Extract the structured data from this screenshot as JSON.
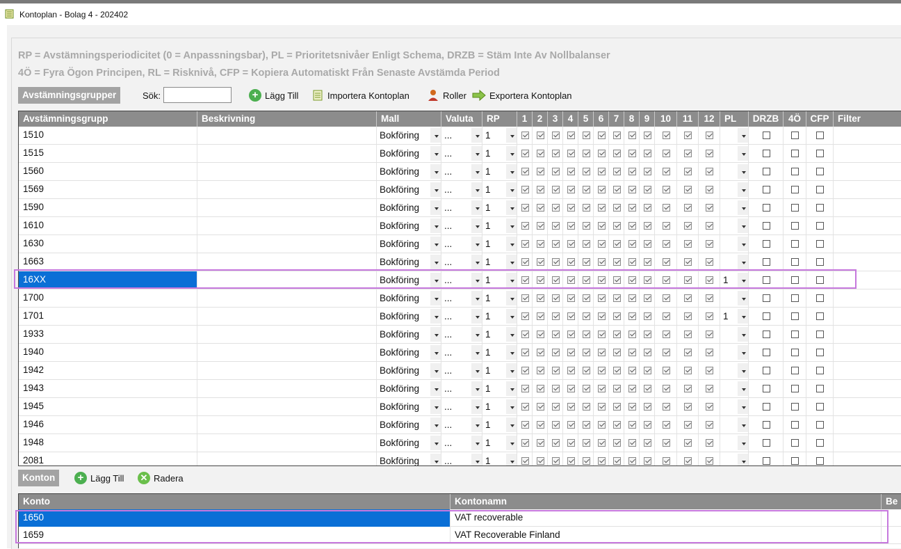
{
  "window": {
    "title": "Kontoplan - Bolag 4 - 202402"
  },
  "legend": {
    "line1": "RP = Avstämningsperiodicitet (0 = Anpassningsbar), PL = Prioritetsnivåer Enligt Schema, DRZB = Stäm Inte Av Nollbalanser",
    "line2": "4Ö = Fyra Ögon Principen, RL = Risknivå, CFP = Kopiera Automatiskt Från Senaste Avstämda Period"
  },
  "groups_toolbar": {
    "section_label": "Avstämningsgrupper",
    "search_label": "Sök:",
    "search_value": "",
    "add_label": "Lägg Till",
    "import_label": "Importera Kontoplan",
    "roles_label": "Roller",
    "export_label": "Exportera Kontoplan"
  },
  "groups_table": {
    "headers": {
      "group": "Avstämningsgrupp",
      "description": "Beskrivning",
      "template": "Mall",
      "currency": "Valuta",
      "rp": "RP",
      "p1": "1",
      "p2": "2",
      "p3": "3",
      "p4": "4",
      "p5": "5",
      "p6": "6",
      "p7": "7",
      "p8": "8",
      "p9": "9",
      "p10": "10",
      "p11": "11",
      "p12": "12",
      "pl": "PL",
      "drzb": "DRZB",
      "fo": "4Ö",
      "cfp": "CFP",
      "filter": "Filter"
    },
    "rows": [
      {
        "group": "1510",
        "description": "",
        "template": "Bokföring",
        "currency": "...",
        "rp": "1",
        "pl": "",
        "drzb": false,
        "fo": false,
        "cfp": false,
        "selected": false
      },
      {
        "group": "1515",
        "description": "",
        "template": "Bokföring",
        "currency": "...",
        "rp": "1",
        "pl": "",
        "drzb": false,
        "fo": false,
        "cfp": false,
        "selected": false
      },
      {
        "group": "1560",
        "description": "",
        "template": "Bokföring",
        "currency": "...",
        "rp": "1",
        "pl": "",
        "drzb": false,
        "fo": false,
        "cfp": false,
        "selected": false
      },
      {
        "group": "1569",
        "description": "",
        "template": "Bokföring",
        "currency": "...",
        "rp": "1",
        "pl": "",
        "drzb": false,
        "fo": false,
        "cfp": false,
        "selected": false
      },
      {
        "group": "1590",
        "description": "",
        "template": "Bokföring",
        "currency": "...",
        "rp": "1",
        "pl": "",
        "drzb": false,
        "fo": false,
        "cfp": false,
        "selected": false
      },
      {
        "group": "1610",
        "description": "",
        "template": "Bokföring",
        "currency": "...",
        "rp": "1",
        "pl": "",
        "drzb": false,
        "fo": false,
        "cfp": false,
        "selected": false
      },
      {
        "group": "1630",
        "description": "",
        "template": "Bokföring",
        "currency": "...",
        "rp": "1",
        "pl": "",
        "drzb": false,
        "fo": false,
        "cfp": false,
        "selected": false
      },
      {
        "group": "1663",
        "description": "",
        "template": "Bokföring",
        "currency": "...",
        "rp": "1",
        "pl": "",
        "drzb": false,
        "fo": false,
        "cfp": false,
        "selected": false
      },
      {
        "group": "16XX",
        "description": "",
        "template": "Bokföring",
        "currency": "...",
        "rp": "1",
        "pl": "1",
        "drzb": false,
        "fo": false,
        "cfp": false,
        "selected": true
      },
      {
        "group": "1700",
        "description": "",
        "template": "Bokföring",
        "currency": "...",
        "rp": "1",
        "pl": "",
        "drzb": false,
        "fo": false,
        "cfp": false,
        "selected": false
      },
      {
        "group": "1701",
        "description": "",
        "template": "Bokföring",
        "currency": "...",
        "rp": "1",
        "pl": "1",
        "drzb": false,
        "fo": false,
        "cfp": false,
        "selected": false
      },
      {
        "group": "1933",
        "description": "",
        "template": "Bokföring",
        "currency": "...",
        "rp": "1",
        "pl": "",
        "drzb": false,
        "fo": false,
        "cfp": false,
        "selected": false
      },
      {
        "group": "1940",
        "description": "",
        "template": "Bokföring",
        "currency": "...",
        "rp": "1",
        "pl": "",
        "drzb": false,
        "fo": false,
        "cfp": false,
        "selected": false
      },
      {
        "group": "1942",
        "description": "",
        "template": "Bokföring",
        "currency": "...",
        "rp": "1",
        "pl": "",
        "drzb": false,
        "fo": false,
        "cfp": false,
        "selected": false
      },
      {
        "group": "1943",
        "description": "",
        "template": "Bokföring",
        "currency": "...",
        "rp": "1",
        "pl": "",
        "drzb": false,
        "fo": false,
        "cfp": false,
        "selected": false
      },
      {
        "group": "1945",
        "description": "",
        "template": "Bokföring",
        "currency": "...",
        "rp": "1",
        "pl": "",
        "drzb": false,
        "fo": false,
        "cfp": false,
        "selected": false
      },
      {
        "group": "1946",
        "description": "",
        "template": "Bokföring",
        "currency": "...",
        "rp": "1",
        "pl": "",
        "drzb": false,
        "fo": false,
        "cfp": false,
        "selected": false
      },
      {
        "group": "1948",
        "description": "",
        "template": "Bokföring",
        "currency": "...",
        "rp": "1",
        "pl": "",
        "drzb": false,
        "fo": false,
        "cfp": false,
        "selected": false
      },
      {
        "group": "2081",
        "description": "",
        "template": "Bokföring",
        "currency": "...",
        "rp": "1",
        "pl": "",
        "drzb": false,
        "fo": false,
        "cfp": false,
        "selected": false
      }
    ]
  },
  "accounts_toolbar": {
    "section_label": "Konton",
    "add_label": "Lägg Till",
    "delete_label": "Radera"
  },
  "accounts_table": {
    "headers": {
      "account": "Konto",
      "name": "Kontonamn",
      "extra": "Be"
    },
    "rows": [
      {
        "account": "1650",
        "name": "VAT recoverable",
        "selected": true
      },
      {
        "account": "1659",
        "name": "VAT Recoverable Finland",
        "selected": false
      }
    ]
  },
  "colors": {
    "accent": "#0a6fd6",
    "highlight": "#c678dd",
    "header": "#8c8c8c",
    "add_icon": "#4caf50"
  }
}
